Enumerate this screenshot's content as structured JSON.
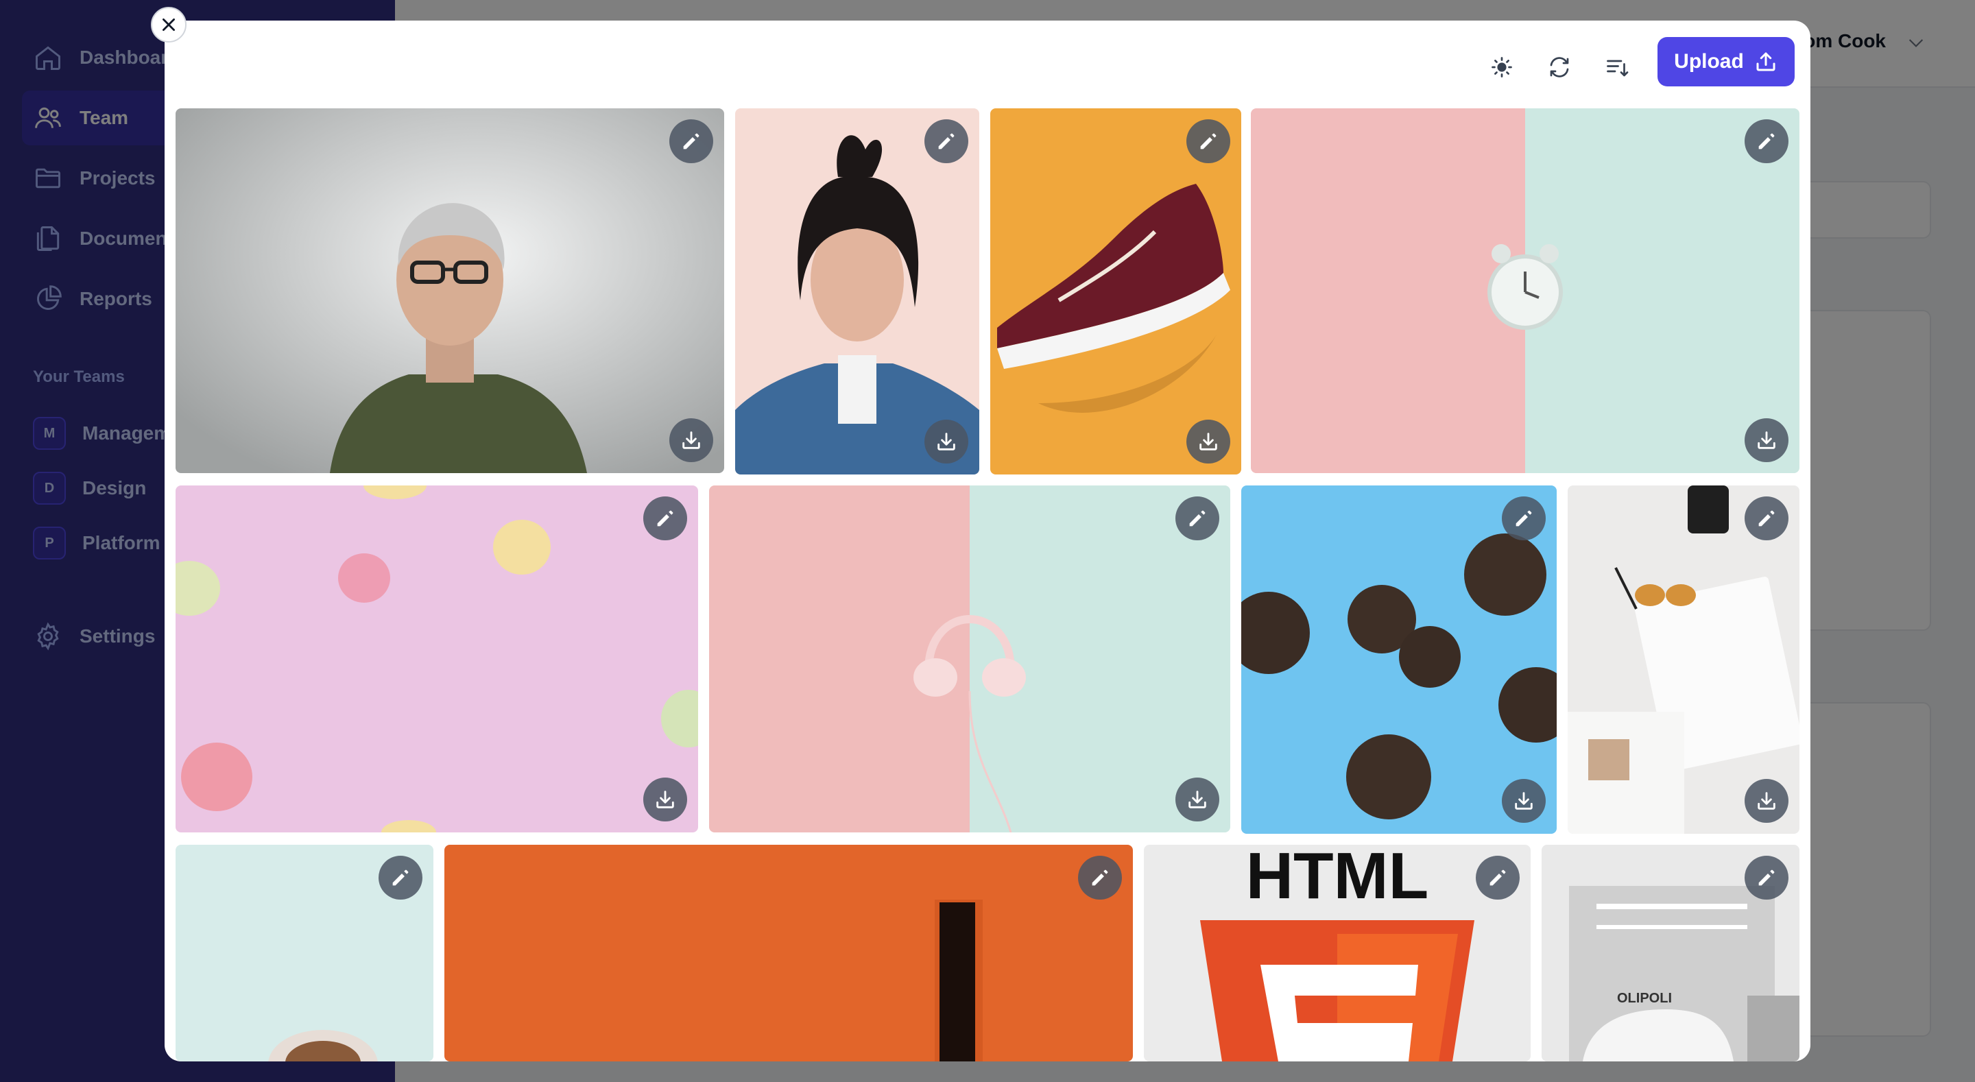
{
  "sidebar": {
    "nav": [
      {
        "label": "Dashboard",
        "icon": "home-icon"
      },
      {
        "label": "Team",
        "icon": "users-icon",
        "active": true
      },
      {
        "label": "Projects",
        "icon": "folder-icon"
      },
      {
        "label": "Documents",
        "icon": "documents-icon"
      },
      {
        "label": "Reports",
        "icon": "chart-pie-icon"
      }
    ],
    "teams_title": "Your Teams",
    "teams": [
      {
        "initial": "M",
        "label": "Management"
      },
      {
        "label": "Design",
        "initial": "D"
      },
      {
        "label": "Platform",
        "initial": "P"
      }
    ],
    "settings_label": "Settings"
  },
  "header": {
    "user_name": "Tom Cook"
  },
  "modal": {
    "upload_label": "Upload",
    "toolbar_icons": [
      "brightness-icon",
      "refresh-icon",
      "sort-icon",
      "upload-icon"
    ],
    "images": [
      {
        "subject": "man-portrait",
        "actions": [
          "edit",
          "download"
        ]
      },
      {
        "subject": "woman-portrait",
        "actions": [
          "edit",
          "download"
        ]
      },
      {
        "subject": "sneaker",
        "actions": [
          "edit",
          "download"
        ]
      },
      {
        "subject": "alarm-clock",
        "actions": [
          "edit",
          "download"
        ]
      },
      {
        "subject": "macarons",
        "actions": [
          "edit",
          "download"
        ]
      },
      {
        "subject": "headphones",
        "actions": [
          "edit",
          "download"
        ]
      },
      {
        "subject": "cookies",
        "actions": [
          "edit",
          "download"
        ]
      },
      {
        "subject": "notebook-desk",
        "actions": [
          "edit",
          "download"
        ]
      },
      {
        "subject": "coffee-cup",
        "actions": [
          "edit"
        ]
      },
      {
        "subject": "orange-wall",
        "actions": [
          "edit"
        ]
      },
      {
        "subject": "html5-logo",
        "actions": [
          "edit"
        ],
        "logo_text": "HTML"
      },
      {
        "subject": "garage-car",
        "actions": [
          "edit"
        ],
        "sign_text": "OLIPOLI"
      }
    ]
  },
  "colors": {
    "sidebar_bg": "#312e81",
    "accent": "#4f46e5",
    "overlay": "rgba(0,0,0,0.5)"
  }
}
